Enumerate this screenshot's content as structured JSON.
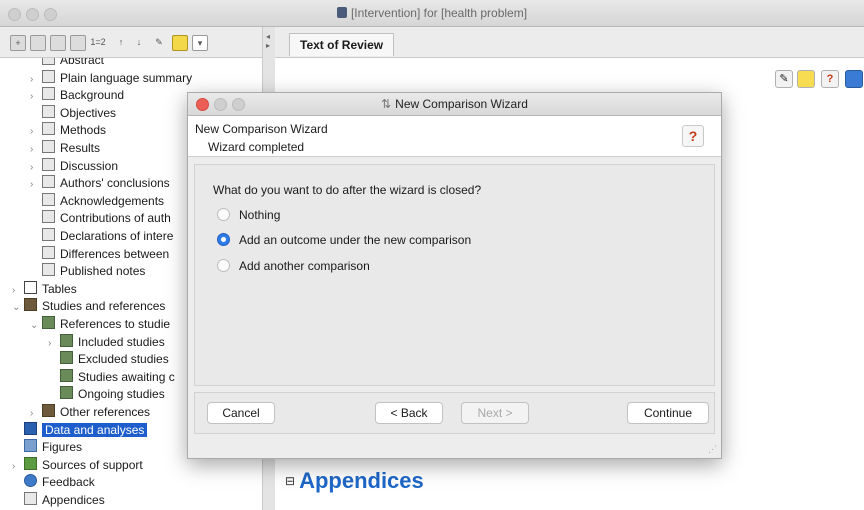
{
  "window": {
    "title": "[Intervention] for [health problem]"
  },
  "tabs": [
    {
      "label": "Text of Review"
    }
  ],
  "content": {
    "heading": "Appendices"
  },
  "tree": [
    {
      "label": "Abstract",
      "chevron": "",
      "icon": "doc"
    },
    {
      "label": "Plain language summary",
      "chevron": "›",
      "icon": "doc"
    },
    {
      "label": "Background",
      "chevron": "›",
      "icon": "doc"
    },
    {
      "label": "Objectives",
      "chevron": "",
      "icon": "doc"
    },
    {
      "label": "Methods",
      "chevron": "›",
      "icon": "doc"
    },
    {
      "label": "Results",
      "chevron": "›",
      "icon": "doc"
    },
    {
      "label": "Discussion",
      "chevron": "›",
      "icon": "doc"
    },
    {
      "label": "Authors' conclusions",
      "chevron": "›",
      "icon": "doc"
    },
    {
      "label": "Acknowledgements",
      "chevron": "",
      "icon": "doc"
    },
    {
      "label": "Contributions of auth",
      "chevron": "",
      "icon": "doc"
    },
    {
      "label": "Declarations of intere",
      "chevron": "",
      "icon": "doc"
    },
    {
      "label": "Differences between",
      "chevron": "",
      "icon": "doc"
    },
    {
      "label": "Published notes",
      "chevron": "",
      "icon": "doc"
    },
    {
      "label": "Tables",
      "chevron": "›",
      "icon": "table"
    },
    {
      "label": "Studies and references",
      "chevron": "⌄",
      "icon": "book"
    },
    {
      "label": "References to studie",
      "chevron": "⌄",
      "icon": "img"
    },
    {
      "label": "Included studies",
      "chevron": "›",
      "icon": "img"
    },
    {
      "label": "Excluded studies",
      "chevron": "",
      "icon": "img"
    },
    {
      "label": "Studies awaiting c",
      "chevron": "",
      "icon": "img"
    },
    {
      "label": "Ongoing studies",
      "chevron": "",
      "icon": "img"
    },
    {
      "label": "Other references",
      "chevron": "›",
      "icon": "book"
    },
    {
      "label": "Data and analyses",
      "chevron": "",
      "icon": "chart",
      "selected": true
    },
    {
      "label": "Figures",
      "chevron": "",
      "icon": "fig"
    },
    {
      "label": "Sources of support",
      "chevron": "›",
      "icon": "support"
    },
    {
      "label": "Feedback",
      "chevron": "",
      "icon": "feedback"
    },
    {
      "label": "Appendices",
      "chevron": "",
      "icon": "doc"
    }
  ],
  "dialog": {
    "title": "New Comparison Wizard",
    "header_title": "New Comparison Wizard",
    "header_subtitle": "Wizard completed",
    "help_glyph": "?",
    "question": "What do you want to do after the wizard is closed?",
    "options": [
      {
        "label": "Nothing",
        "selected": false
      },
      {
        "label": "Add an outcome under the new comparison",
        "selected": true
      },
      {
        "label": "Add another comparison",
        "selected": false
      }
    ],
    "buttons": {
      "cancel": "Cancel",
      "back": "< Back",
      "next": "Next >",
      "continue": "Continue"
    }
  },
  "toolbar": {
    "mini_icon_label": "1=2"
  }
}
